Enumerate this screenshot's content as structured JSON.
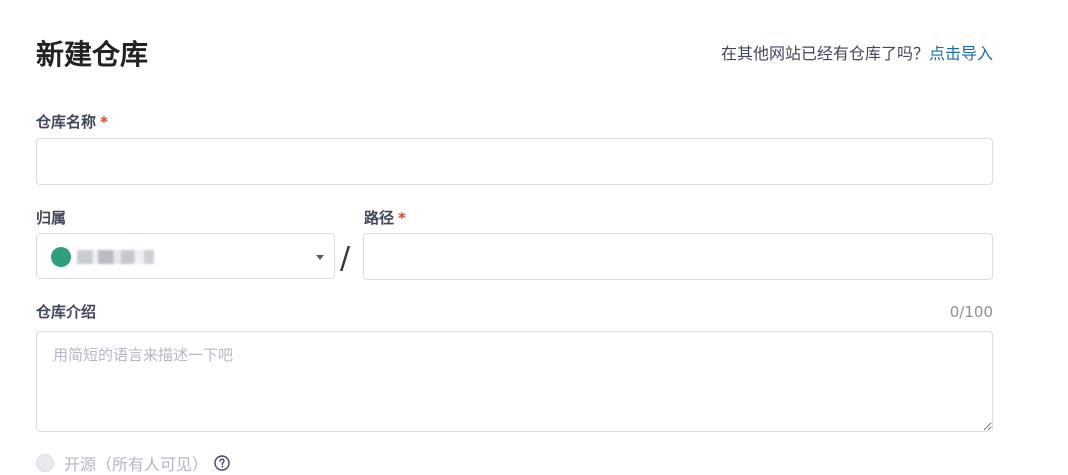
{
  "header": {
    "title": "新建仓库",
    "import_prompt": "在其他网站已经有仓库了吗？",
    "import_link": "点击导入"
  },
  "form": {
    "repo_name": {
      "label": "仓库名称",
      "required_mark": "*",
      "value": ""
    },
    "owner": {
      "label": "归属",
      "selected": ""
    },
    "path_separator": "/",
    "path": {
      "label": "路径",
      "required_mark": "*",
      "value": ""
    },
    "description": {
      "label": "仓库介绍",
      "counter": "0/100",
      "placeholder": "用简短的语言来描述一下吧",
      "value": ""
    },
    "visibility": {
      "open_source_label": "开源（所有人可见）",
      "help_icon": "question-circle-icon"
    }
  },
  "colors": {
    "link": "#1b6cb0",
    "required": "#e0432f",
    "avatar": "#2f9e7f"
  }
}
